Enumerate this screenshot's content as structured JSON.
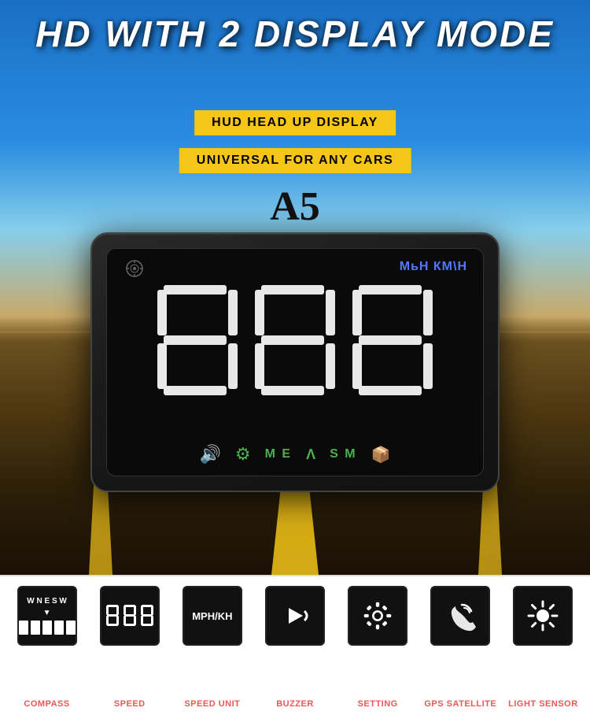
{
  "header": {
    "title": "HD WITH 2 DISPLAY MODE",
    "badge1": "HUD HEAD UP DISPLAY",
    "badge2": "UNIVERSAL FOR ANY CARS",
    "model": "A5"
  },
  "hud": {
    "speed_unit": "МЬНКМ\\Н",
    "speaker_symbol": "◈",
    "bottom_icons_text": "🔊  ⚙  M E Л S M 📦"
  },
  "features": [
    {
      "label": "COMPASS",
      "type": "compass",
      "content": "WNESW"
    },
    {
      "label": "SPEED",
      "type": "speed",
      "content": "888"
    },
    {
      "label": "SPEED UNIT",
      "type": "text",
      "content": "MPH/KH"
    },
    {
      "label": "BUZZER",
      "type": "buzzer",
      "content": "▶"
    },
    {
      "label": "SETTING",
      "type": "gear",
      "content": "⚙"
    },
    {
      "label": "GPS SATELLITE",
      "type": "gps",
      "content": "📡"
    },
    {
      "label": "LIGHT SENSOR",
      "type": "light",
      "content": "✳"
    }
  ],
  "colors": {
    "title_white": "#ffffff",
    "badge_yellow": "#f5c518",
    "accent_blue": "#2a8de0",
    "feature_label_red": "#e55555",
    "hud_bg": "#111111"
  }
}
